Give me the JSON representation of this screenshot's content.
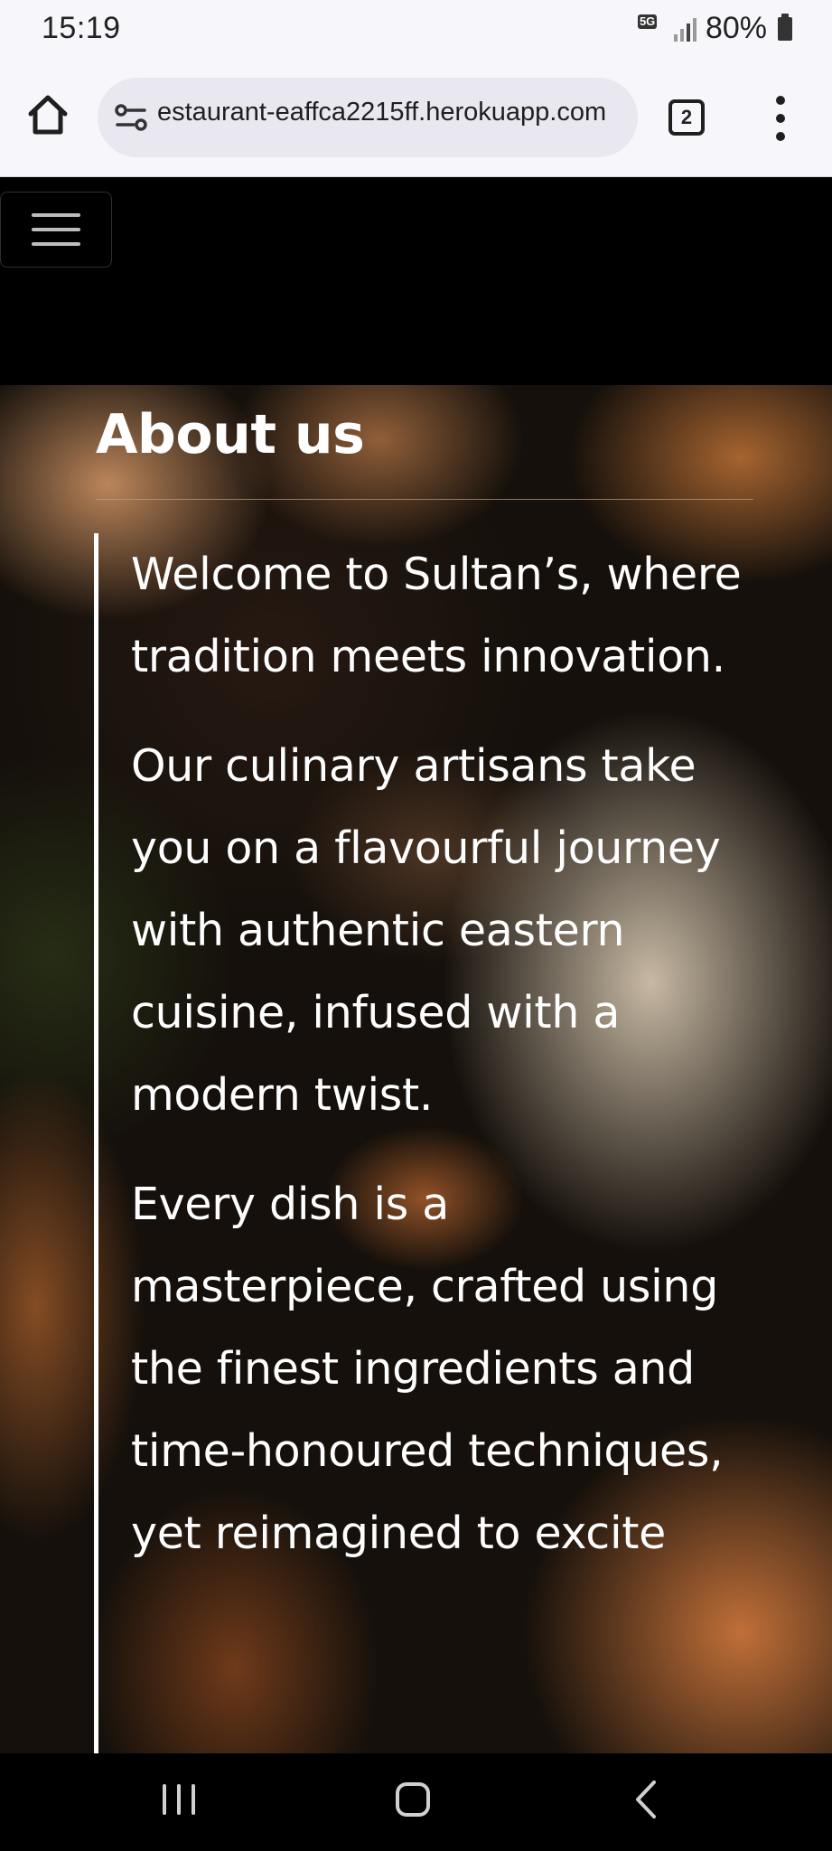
{
  "status_bar": {
    "time": "15:19",
    "network_badge": "5G",
    "battery_percent": "80%"
  },
  "browser": {
    "url": "estaurant-eaffca2215ff.herokuapp.com",
    "tab_count": "2"
  },
  "about": {
    "title": "About us",
    "paragraphs": [
      "Welcome to Sultan’s, where tradition meets innovation.",
      "Our culinary artisans take you on a flavourful journey with authentic eastern cuisine, infused with a modern twist.",
      "Every dish is a masterpiece, crafted using the finest ingredients and time-honoured techniques, yet reimagined to excite"
    ]
  },
  "colors": {
    "page_background": "#000000",
    "heading_text": "#ffffff",
    "quote_border": "#ffffff",
    "browser_chrome": "#f7f6fb"
  }
}
